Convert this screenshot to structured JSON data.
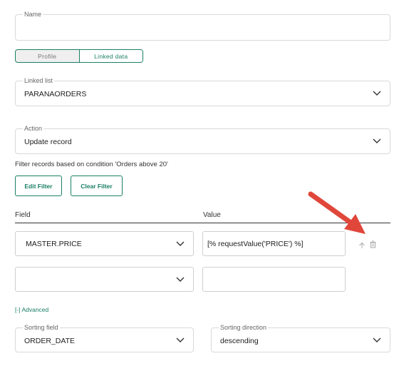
{
  "name_field": {
    "legend": "Name",
    "value": ""
  },
  "tabs": [
    {
      "label": "Profile",
      "active": false
    },
    {
      "label": "Linked data",
      "active": true
    }
  ],
  "linked_list": {
    "legend": "Linked list",
    "value": "PARANAORDERS"
  },
  "action": {
    "legend": "Action",
    "value": "Update record"
  },
  "filter": {
    "description": "Filter records based on condition 'Orders above 20'",
    "edit_label": "Edit Filter",
    "clear_label": "Clear Filter"
  },
  "table": {
    "field_header": "Field",
    "value_header": "Value",
    "rows": [
      {
        "field": "MASTER.PRICE",
        "value": "[% requestValue('PRICE') %]"
      },
      {
        "field": "",
        "value": ""
      }
    ]
  },
  "advanced": {
    "label": "[-] Advanced"
  },
  "sorting": {
    "field_legend": "Sorting field",
    "field_value": "ORDER_DATE",
    "direction_legend": "Sorting direction",
    "direction_value": "descending"
  },
  "colors": {
    "accent": "#1a7f64",
    "annotation_arrow": "#e0463a"
  }
}
